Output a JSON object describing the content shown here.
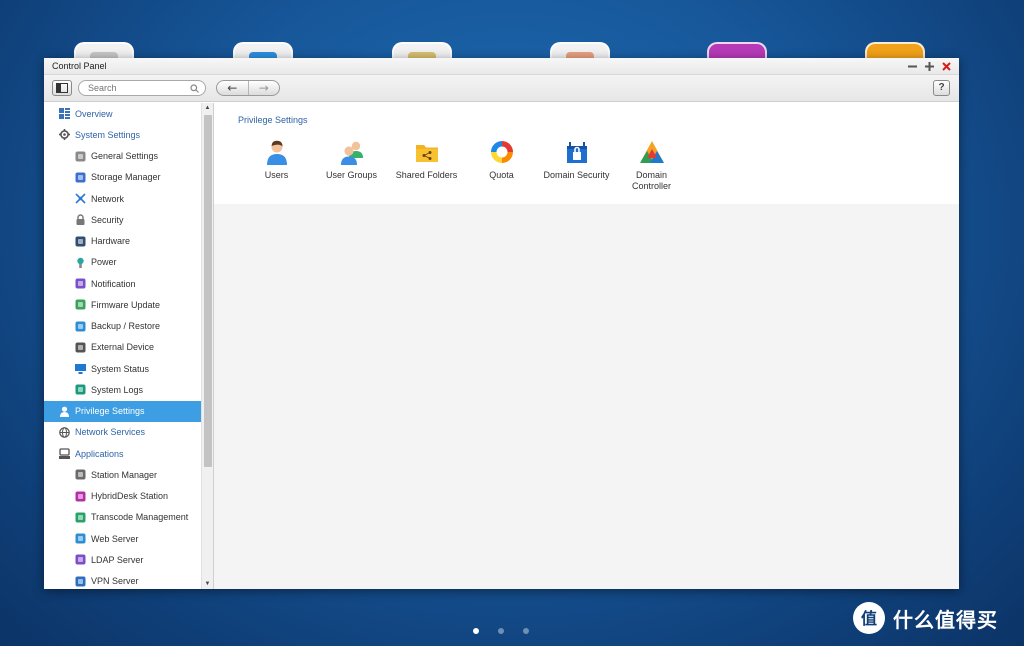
{
  "window": {
    "title": "Control Panel"
  },
  "toolbar": {
    "search_placeholder": "Search",
    "back_glyph": "←",
    "forward_glyph": "→",
    "help_label": "?"
  },
  "sidebar": {
    "items": [
      {
        "label": "Overview",
        "level": "top",
        "icon": "overview-icon",
        "color": "#3b74b5"
      },
      {
        "label": "System Settings",
        "level": "top",
        "icon": "gear-icon",
        "color": "#555555"
      },
      {
        "label": "General Settings",
        "level": "sub",
        "icon": "general-settings-icon",
        "color": "#8a8a8a"
      },
      {
        "label": "Storage Manager",
        "level": "sub",
        "icon": "storage-icon",
        "color": "#3d6fd0"
      },
      {
        "label": "Network",
        "level": "sub",
        "icon": "network-icon",
        "color": "#2c7ad6"
      },
      {
        "label": "Security",
        "level": "sub",
        "icon": "lock-icon",
        "color": "#777777"
      },
      {
        "label": "Hardware",
        "level": "sub",
        "icon": "hardware-icon",
        "color": "#2f4f72"
      },
      {
        "label": "Power",
        "level": "sub",
        "icon": "power-icon",
        "color": "#2aa7a0"
      },
      {
        "label": "Notification",
        "level": "sub",
        "icon": "notification-icon",
        "color": "#7a4fc9"
      },
      {
        "label": "Firmware Update",
        "level": "sub",
        "icon": "firmware-icon",
        "color": "#3aa35a"
      },
      {
        "label": "Backup / Restore",
        "level": "sub",
        "icon": "backup-icon",
        "color": "#2a8fd6"
      },
      {
        "label": "External Device",
        "level": "sub",
        "icon": "external-device-icon",
        "color": "#555555"
      },
      {
        "label": "System Status",
        "level": "sub",
        "icon": "monitor-icon",
        "color": "#1e7ad1"
      },
      {
        "label": "System Logs",
        "level": "sub",
        "icon": "logs-icon",
        "color": "#1a9a7a"
      },
      {
        "label": "Privilege Settings",
        "level": "top",
        "icon": "user-icon",
        "color": "#ffffff",
        "active": true
      },
      {
        "label": "Network Services",
        "level": "top",
        "icon": "globe-icon",
        "color": "#555555"
      },
      {
        "label": "Applications",
        "level": "top",
        "icon": "applications-icon",
        "color": "#555555"
      },
      {
        "label": "Station Manager",
        "level": "sub",
        "icon": "station-icon",
        "color": "#6a6a6a"
      },
      {
        "label": "HybridDesk Station",
        "level": "sub",
        "icon": "hybriddesk-icon",
        "color": "#b530a8"
      },
      {
        "label": "Transcode Management",
        "level": "sub",
        "icon": "transcode-icon",
        "color": "#27a36a"
      },
      {
        "label": "Web Server",
        "level": "sub",
        "icon": "web-icon",
        "color": "#2a8fd6"
      },
      {
        "label": "LDAP Server",
        "level": "sub",
        "icon": "ldap-icon",
        "color": "#7a4fc9"
      },
      {
        "label": "VPN Server",
        "level": "sub",
        "icon": "vpn-icon",
        "color": "#2a6fc0"
      }
    ]
  },
  "main": {
    "section_title": "Privilege Settings",
    "tiles": [
      {
        "label": "Users",
        "icon": "users-icon"
      },
      {
        "label": "User Groups",
        "icon": "user-groups-icon"
      },
      {
        "label": "Shared Folders",
        "icon": "shared-folders-icon"
      },
      {
        "label": "Quota",
        "icon": "quota-icon"
      },
      {
        "label": "Domain Security",
        "icon": "domain-security-icon"
      },
      {
        "label": "Domain Controller",
        "icon": "domain-controller-icon"
      }
    ]
  },
  "desktop": {
    "icon_colors": [
      "#c8c8c8",
      "#2d8fe0",
      "#d8c070",
      "#e8a080",
      "#b63ab8",
      "#f2a21a"
    ],
    "pages": 3,
    "active_page": 1
  },
  "watermark": {
    "text": "什么值得买",
    "logo_glyph": "值"
  },
  "colors": {
    "accent": "#3d9ee3",
    "link": "#2e63a6",
    "close": "#d41d1d"
  }
}
